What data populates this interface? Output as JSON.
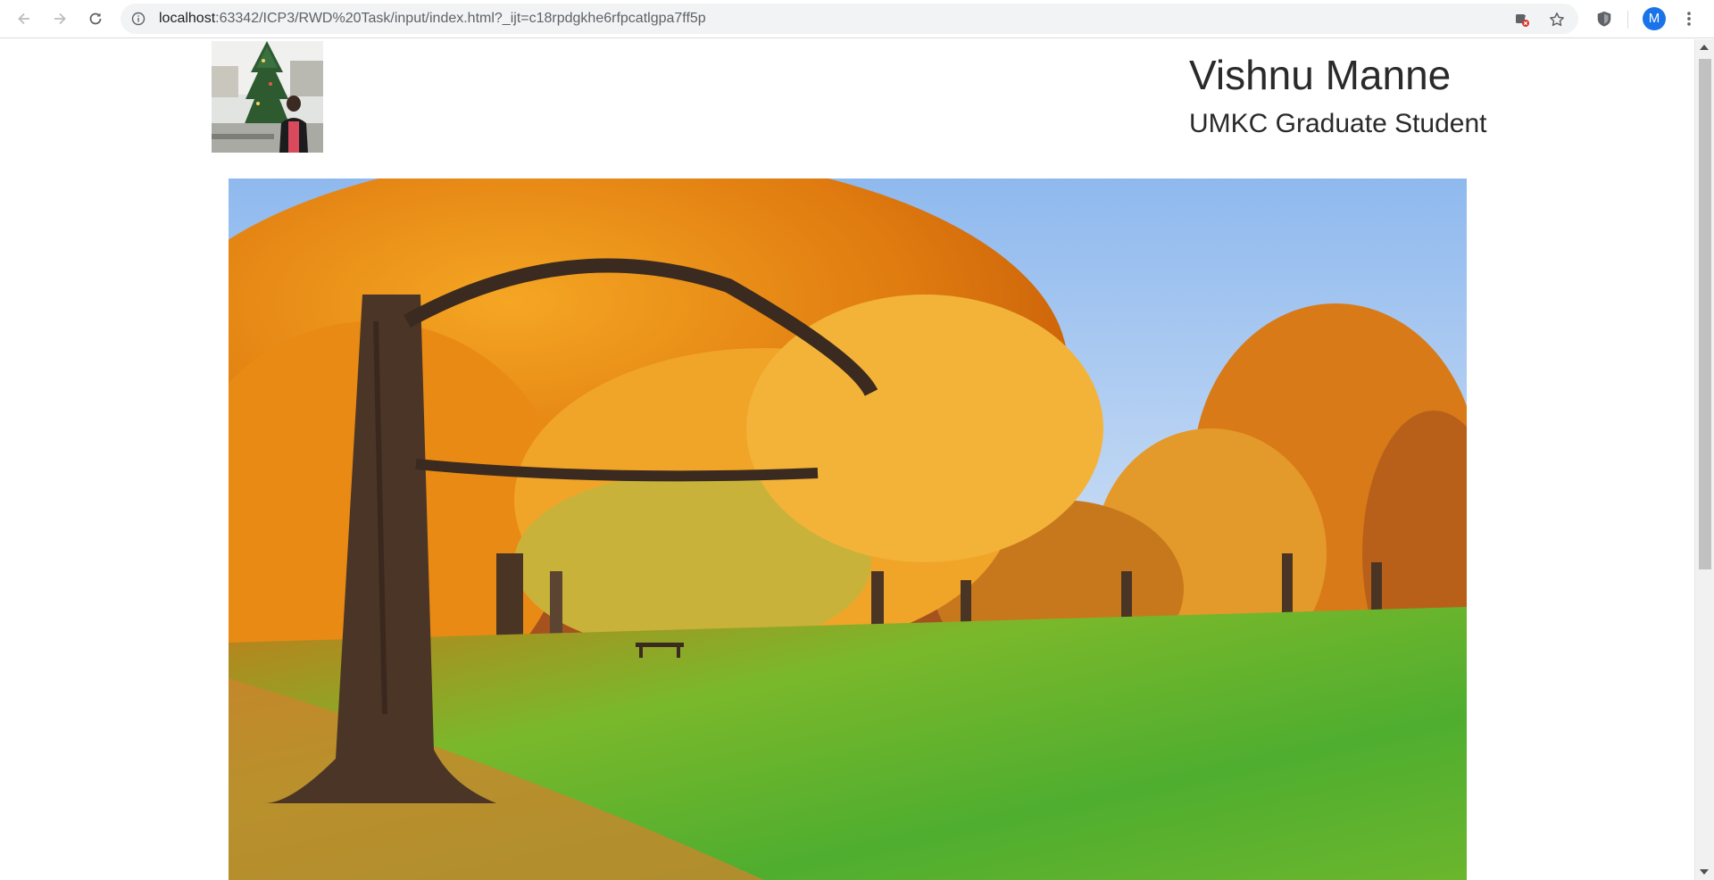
{
  "browser": {
    "url_host": "localhost",
    "url_rest": ":63342/ICP3/RWD%20Task/input/index.html?_ijt=c18rpdgkhe6rfpcatlgpa7ff5p",
    "profile_initial": "M",
    "icons": [
      "back-icon",
      "forward-icon",
      "reload-icon",
      "info-icon",
      "translate-blocked-icon",
      "bookmark-star-icon",
      "extension-shield-icon",
      "more-menu-icon"
    ]
  },
  "page": {
    "name": "Vishnu Manne",
    "subtitle": "UMKC Graduate Student"
  },
  "colors": {
    "text": "#2a2a2a",
    "omnibox_bg": "#f1f3f4",
    "avatar": "#1a73e8",
    "scroll_thumb": "#c1c1c1"
  }
}
